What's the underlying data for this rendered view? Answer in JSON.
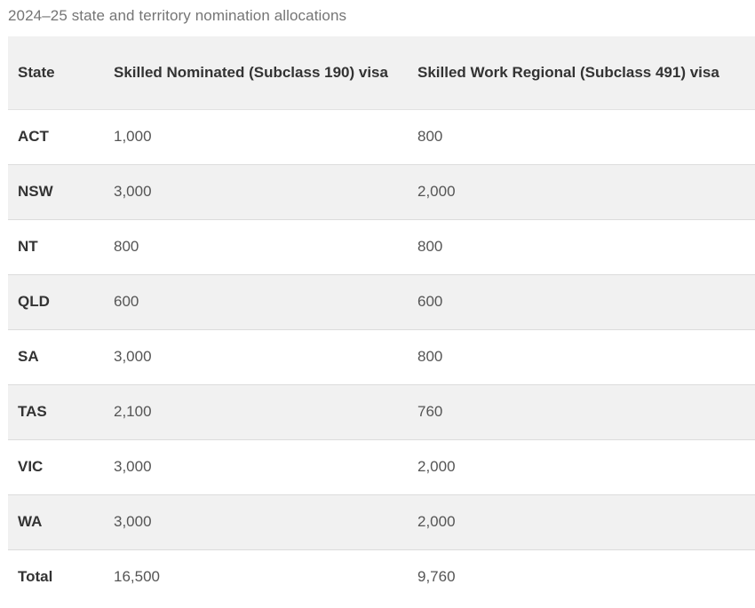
{
  "caption": "2024–25 state and territory nomination allocations",
  "table": {
    "headers": [
      "State",
      "Skilled Nominated (Subclass 190) visa",
      "Skilled Work Regional (Subclass 491) visa"
    ],
    "rows": [
      [
        "ACT",
        "1,000",
        "800"
      ],
      [
        "NSW",
        "3,000",
        "2,000"
      ],
      [
        "NT",
        "800",
        "800"
      ],
      [
        "QLD",
        "600",
        "600"
      ],
      [
        "SA",
        "3,000",
        "800"
      ],
      [
        "TAS",
        "2,100",
        "760"
      ],
      [
        "VIC",
        "3,000",
        "2,000"
      ],
      [
        "WA",
        "3,000",
        "2,000"
      ],
      [
        "Total",
        "16,500",
        "9,760"
      ]
    ]
  },
  "colors": {
    "header_bg": "#f1f1f1",
    "stripe_bg": "#f1f1f1",
    "row_bg": "#ffffff",
    "caption_text": "#757575",
    "body_text": "#333333"
  }
}
